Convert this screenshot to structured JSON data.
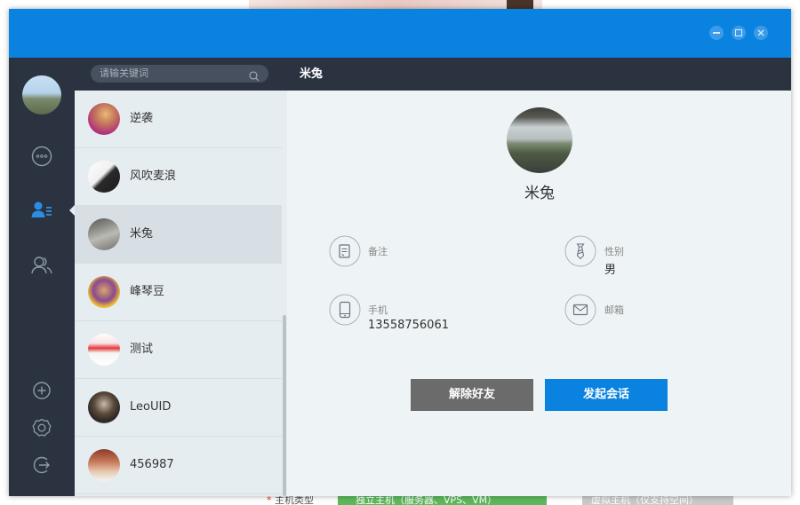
{
  "window": {
    "controls": [
      "minimize-icon",
      "maximize-icon",
      "close-icon"
    ]
  },
  "nav": {
    "items": [
      {
        "name": "chat-icon",
        "active": false
      },
      {
        "name": "contacts-icon",
        "active": true
      },
      {
        "name": "groups-icon",
        "active": false
      },
      {
        "name": "add-icon",
        "active": false
      },
      {
        "name": "settings-icon",
        "active": false
      },
      {
        "name": "logout-icon",
        "active": false
      }
    ]
  },
  "search": {
    "placeholder": "请输关键词"
  },
  "contacts": [
    {
      "name": "逆袭",
      "selected": false
    },
    {
      "name": "风吹麦浪",
      "selected": false
    },
    {
      "name": "米兔",
      "selected": true
    },
    {
      "name": "峰琴豆",
      "selected": false
    },
    {
      "name": "测试",
      "selected": false
    },
    {
      "name": "LeoUID",
      "selected": false
    },
    {
      "name": "456987",
      "selected": false
    }
  ],
  "detail": {
    "header_title": "米兔",
    "name": "米兔",
    "fields": {
      "remark_label": "备注",
      "remark_value": "",
      "gender_label": "性别",
      "gender_value": "男",
      "phone_label": "手机",
      "phone_value": "13558756061",
      "email_label": "邮箱",
      "email_value": ""
    },
    "buttons": {
      "remove_label": "解除好友",
      "chat_label": "发起会话"
    }
  },
  "colors": {
    "titlebar": "#0a83e0",
    "sidebar": "#2b3340",
    "accent_button": "#0a83e0",
    "neutral_button": "#6b6b6b",
    "active_nav": "#2b8ee6"
  },
  "background_page": {
    "bottom_left_text": "主机类型",
    "bottom_mid_text": "独立主机（服务器、VPS、VM）",
    "bottom_right_text": "虚拟主机（仅支持空间）"
  }
}
